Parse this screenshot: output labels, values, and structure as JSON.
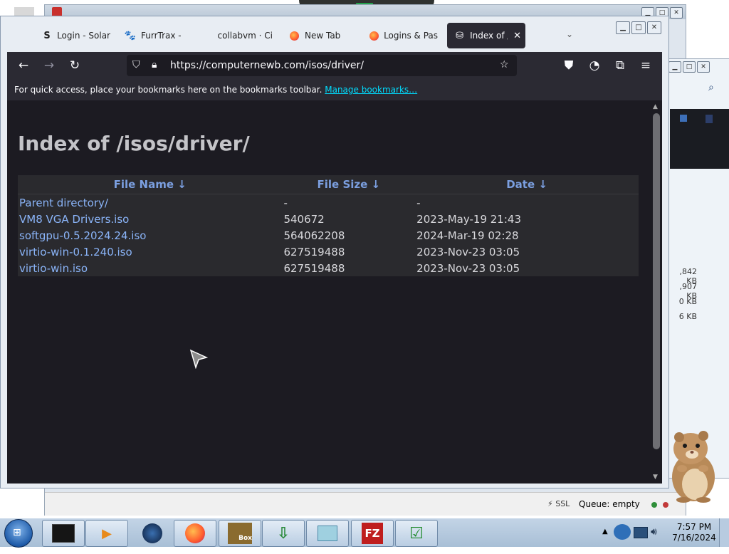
{
  "filezilla": {
    "title": "",
    "queue_label": "Queue: empty",
    "status_icons": "⚡ SSL"
  },
  "explorer": {
    "sizes": [
      ",842 KB",
      ",907 KB",
      "0 KB",
      "6 KB"
    ]
  },
  "browser": {
    "tabs": [
      {
        "label": "Login - Solar",
        "icon": "s-logo-icon"
      },
      {
        "label": "FurrTrax -",
        "icon": "paw-icon"
      },
      {
        "label": "collabvm · Ci",
        "icon": "blank-icon"
      },
      {
        "label": "New Tab",
        "icon": "firefox-icon"
      },
      {
        "label": "Logins & Pas",
        "icon": "firefox-icon"
      },
      {
        "label": "Index of /is",
        "icon": "server-icon"
      }
    ],
    "url": "https://computernewb.com/isos/driver/",
    "bookmarks_text": "For quick access, place your bookmarks here on the bookmarks toolbar.",
    "bookmarks_link": "Manage bookmarks…"
  },
  "page": {
    "heading": "Index of /isos/driver/",
    "columns": [
      "File Name  ↓",
      "File Size  ↓",
      "Date  ↓"
    ],
    "rows": [
      {
        "name": "Parent directory/",
        "size": "-",
        "date": "-"
      },
      {
        "name": "VM8 VGA Drivers.iso",
        "size": "540672",
        "date": "2023-May-19 21:43"
      },
      {
        "name": "softgpu-0.5.2024.24.iso",
        "size": "564062208",
        "date": "2024-Mar-19 02:28"
      },
      {
        "name": "virtio-win-0.1.240.iso",
        "size": "627519488",
        "date": "2023-Nov-23 03:05"
      },
      {
        "name": "virtio-win.iso",
        "size": "627519488",
        "date": "2023-Nov-23 03:05"
      }
    ]
  },
  "taskbar": {
    "time": "7:57 PM",
    "date": "7/16/2024",
    "apps": [
      "terminal-icon",
      "media-player-icon",
      "globe-icon",
      "firefox-icon",
      "virtualbox-icon",
      "download-manager-icon",
      "notes-icon",
      "filezilla-icon",
      "checklist-icon"
    ],
    "labels": {
      "filezilla": "FZ",
      "virtualbox": "Box"
    }
  },
  "colors": {
    "content_bg": "#1c1b22",
    "toolbar_bg": "#2b2a33",
    "link": "#8ab4f8",
    "header": "#7b9fe0",
    "bookmark_link": "#00ddff"
  }
}
